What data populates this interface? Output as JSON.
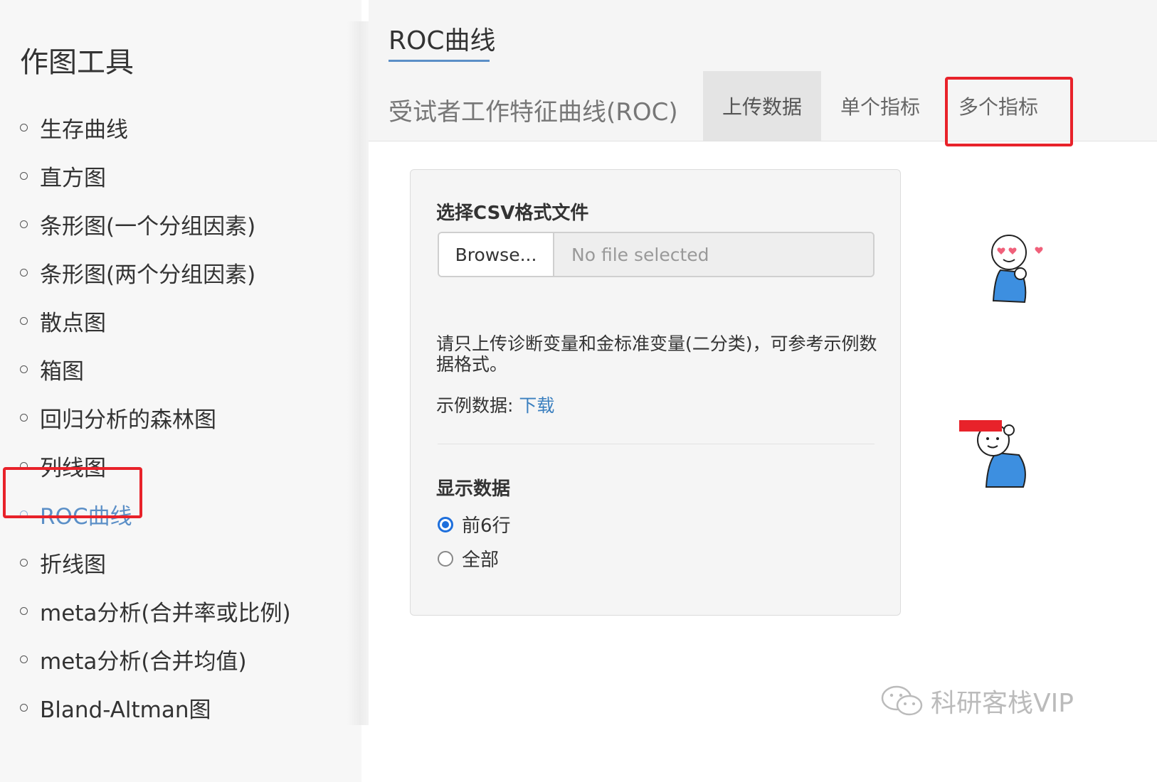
{
  "sidebar": {
    "title": "作图工具",
    "items": [
      {
        "label": "生存曲线"
      },
      {
        "label": "直方图"
      },
      {
        "label": "条形图(一个分组因素)"
      },
      {
        "label": "条形图(两个分组因素)"
      },
      {
        "label": "散点图"
      },
      {
        "label": "箱图"
      },
      {
        "label": "回归分析的森林图"
      },
      {
        "label": "列线图"
      },
      {
        "label": "ROC曲线",
        "active": true
      },
      {
        "label": "折线图"
      },
      {
        "label": "meta分析(合并率或比例)"
      },
      {
        "label": "meta分析(合并均值)"
      },
      {
        "label": "Bland-Altman图"
      }
    ]
  },
  "main": {
    "title": "ROC曲线",
    "subtitle": "受试者工作特征曲线(ROC)",
    "tabs": [
      {
        "label": "上传数据",
        "active": true
      },
      {
        "label": "单个指标"
      },
      {
        "label": "多个指标"
      }
    ],
    "panel": {
      "file_label": "选择CSV格式文件",
      "browse_label": "Browse...",
      "file_placeholder": "No file selected",
      "help_text": "请只上传诊断变量和金标准变量(二分类)，可参考示例数据格式。",
      "example_prefix": "示例数据: ",
      "download_label": "下载",
      "display_label": "显示数据",
      "radio_options": [
        {
          "label": "前6行",
          "checked": true
        },
        {
          "label": "全部",
          "checked": false
        }
      ]
    }
  },
  "watermark": "科研客栈VIP",
  "colors": {
    "accent": "#5b8fc7",
    "highlight_box": "#e8222a",
    "radio_checked": "#1e6fdc",
    "link": "#3a7fbf"
  }
}
